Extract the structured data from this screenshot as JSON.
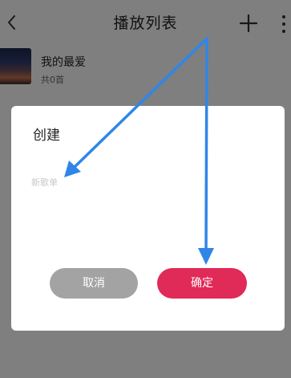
{
  "header": {
    "title": "播放列表"
  },
  "playlist": {
    "name": "我的最爱",
    "count": "共0首"
  },
  "dialog": {
    "title": "创建",
    "input_placeholder": "新歌单",
    "cancel_label": "取消",
    "confirm_label": "确定"
  },
  "icons": {
    "back": "chevron-left-icon",
    "add": "plus-icon",
    "more": "more-vertical-icon"
  },
  "colors": {
    "confirm": "#e02a57",
    "cancel": "#a3a3a3",
    "arrow": "#2f86e8"
  }
}
